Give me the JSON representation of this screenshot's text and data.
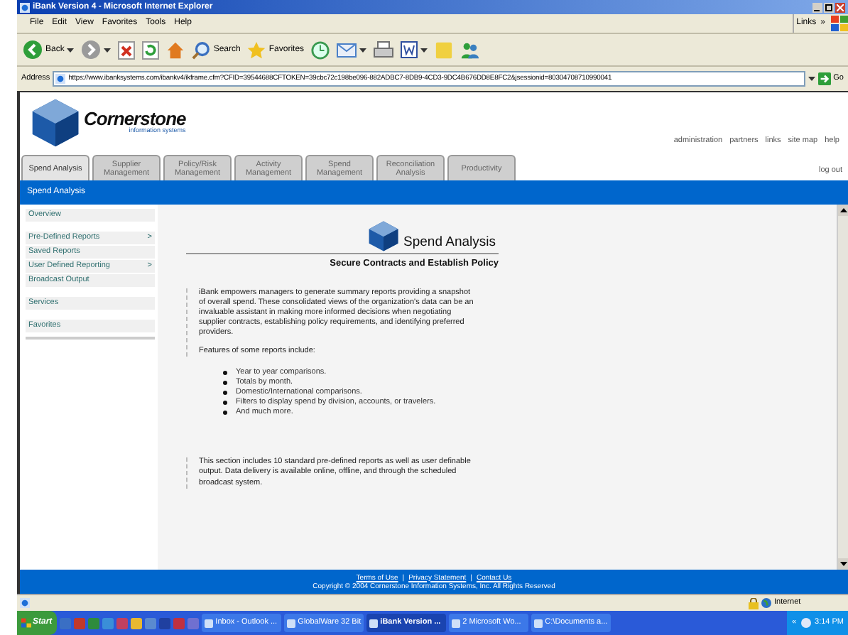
{
  "window": {
    "title": "iBank Version 4 - Microsoft Internet Explorer"
  },
  "menu": [
    "File",
    "Edit",
    "View",
    "Favorites",
    "Tools",
    "Help"
  ],
  "links_label": "Links",
  "links_more": "»",
  "toolbar": [
    {
      "kind": "back",
      "label": "Back"
    },
    {
      "kind": "forward"
    },
    {
      "kind": "stop"
    },
    {
      "kind": "refresh"
    },
    {
      "kind": "home"
    },
    {
      "kind": "search",
      "label": "Search"
    },
    {
      "kind": "favorites",
      "label": "Favorites"
    },
    {
      "kind": "history"
    },
    {
      "kind": "mail"
    },
    {
      "kind": "print"
    },
    {
      "kind": "word"
    },
    {
      "kind": "notes"
    },
    {
      "kind": "messenger"
    }
  ],
  "address": {
    "label": "Address",
    "url": "https://www.ibanksystems.com/ibankv4/ikframe.cfm?CFID=39544688CFTOKEN=39cbc72c198be096-882ADBC7-8DB9-4CD3-9DC4B676DD8E8FC2&jsessionid=80304708710990041",
    "go": "Go"
  },
  "page": {
    "logo": {
      "name": "Cornerstone",
      "tagline": "information systems"
    },
    "top_links": [
      "administration",
      "partners",
      "links",
      "site map",
      "help"
    ],
    "tabs": [
      {
        "label": "Spend Analysis",
        "selected": true
      },
      {
        "label": "Supplier Management",
        "selected": false
      },
      {
        "label": "Policy/Risk Management",
        "selected": false
      },
      {
        "label": "Activity Management",
        "selected": false
      },
      {
        "label": "Spend Management",
        "selected": false
      },
      {
        "label": "Reconciliation Analysis",
        "selected": false
      },
      {
        "label": "Productivity",
        "selected": false
      }
    ],
    "logout": "log out",
    "section_title": "Spend Analysis",
    "sidebar": {
      "groups": [
        [
          {
            "label": "Overview"
          }
        ],
        [
          {
            "label": "Pre-Defined Reports",
            "arrow": ">"
          },
          {
            "label": "Saved Reports"
          },
          {
            "label": "User Defined Reporting",
            "arrow": ">"
          },
          {
            "label": "Broadcast Output"
          }
        ],
        [
          {
            "label": "Services"
          }
        ],
        [
          {
            "label": "Favorites"
          }
        ]
      ]
    },
    "content": {
      "heading": "Spend Analysis",
      "subheading": "Secure Contracts and Establish Policy",
      "intro": "iBank empowers managers to generate summary reports providing a snapshot of overall spend. These consolidated views of the organization's data can be an invaluable assistant in making more informed decisions when negotiating supplier contracts, establishing policy requirements, and identifying preferred providers.",
      "features_label": "Features of some reports include:",
      "features": [
        "Year to year comparisons.",
        "Totals by month.",
        "Domestic/International comparisons.",
        "Filters to display spend by division, accounts, or travelers.",
        "And much more."
      ],
      "closing": "This section includes 10 standard pre-defined reports as well as user definable output.  Data delivery is available online, offline, and through the scheduled broadcast system."
    },
    "footer": {
      "links": [
        "Terms of Use",
        "Privacy Statement",
        "Contact Us"
      ],
      "separator": "|",
      "copyright": "Copyright © 2004 Cornerstone Information Systems, Inc. All Rights Reserved"
    }
  },
  "status_bar": {
    "zone": "Internet"
  },
  "taskbar": {
    "start": "Start",
    "quick_launch": [
      {
        "color": "#3a6fc4"
      },
      {
        "color": "#c0392b"
      },
      {
        "color": "#2e8b3d"
      },
      {
        "color": "#3a8fd8"
      },
      {
        "color": "#c04060"
      },
      {
        "color": "#e8b830"
      },
      {
        "color": "#5a8ad0"
      },
      {
        "color": "#2040a0"
      },
      {
        "color": "#c03040"
      },
      {
        "color": "#7070d0"
      }
    ],
    "tasks": [
      {
        "label": "Inbox - Outlook ...",
        "selected": false
      },
      {
        "label": "GlobalWare 32 Bit",
        "selected": false
      },
      {
        "label": "iBank Version ...",
        "selected": true
      },
      {
        "label": "2 Microsoft Wo...",
        "selected": false
      },
      {
        "label": "C:\\Documents a...",
        "selected": false
      }
    ],
    "tray_more": "«",
    "clock": "3:14 PM"
  }
}
